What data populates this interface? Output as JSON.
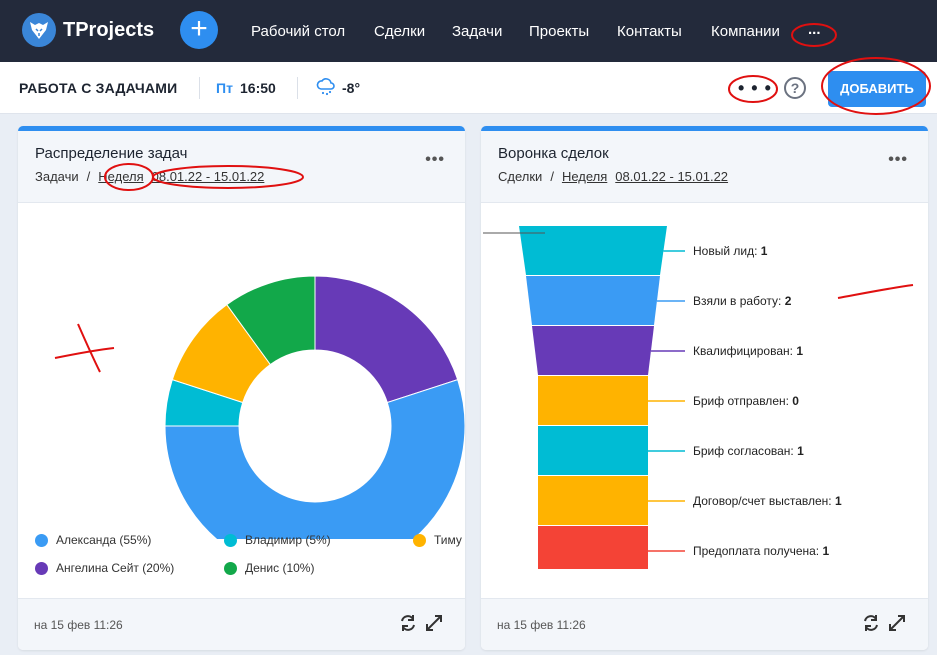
{
  "app": {
    "brand": "TProjects"
  },
  "nav": {
    "items": [
      {
        "label": "Рабочий стол"
      },
      {
        "label": "Сделки"
      },
      {
        "label": "Задачи"
      },
      {
        "label": "Проекты"
      },
      {
        "label": "Контакты"
      },
      {
        "label": "Компании"
      },
      {
        "label": "..."
      }
    ]
  },
  "subheader": {
    "title": "РАБОТА С ЗАДАЧАМИ",
    "day": "Пт",
    "time": "16:50",
    "temperature": "-8°",
    "more": "• • •",
    "help": "?",
    "add_label": "ДОБАВИТЬ"
  },
  "widget_tasks": {
    "title": "Распределение задач",
    "crumb_root": "Задачи",
    "crumb_sep": "/",
    "period": "Неделя",
    "range": "08.01.22 - 15.01.22",
    "menu": "•••",
    "footer": "на 15 фев 11:26",
    "chart_data": {
      "type": "pie",
      "series": [
        {
          "name": "Александа (55%)",
          "value": 55,
          "color": "#3a9bf4"
        },
        {
          "name": "Владимир (5%)",
          "value": 5,
          "color": "#00bcd4"
        },
        {
          "name": "Тиму",
          "value": 10,
          "color": "#ffb300"
        },
        {
          "name": "Денис (10%)",
          "value": 10,
          "color": "#12a84a"
        },
        {
          "name": "Ангелина Сейт (20%)",
          "value": 20,
          "color": "#673ab7"
        }
      ]
    }
  },
  "widget_deals": {
    "title": "Воронка сделок",
    "crumb_root": "Сделки",
    "crumb_sep": "/",
    "period": "Неделя",
    "range": "08.01.22 - 15.01.22",
    "menu": "•••",
    "footer": "на 15 фев 11:26",
    "stages": [
      {
        "label": "Новый лид:",
        "count": "1",
        "color": "#00bcd4"
      },
      {
        "label": "Взяли в работу:",
        "count": "2",
        "color": "#3a9bf4"
      },
      {
        "label": "Квалифицирован:",
        "count": "1",
        "color": "#673ab7"
      },
      {
        "label": "Бриф отправлен:",
        "count": "0",
        "color": "#ffb300"
      },
      {
        "label": "Бриф согласован:",
        "count": "1",
        "color": "#00bcd4"
      },
      {
        "label": "Договор/счет выставлен:",
        "count": "1",
        "color": "#ffb300"
      },
      {
        "label": "Предоплата получена:",
        "count": "1",
        "color": "#f44336"
      }
    ]
  }
}
